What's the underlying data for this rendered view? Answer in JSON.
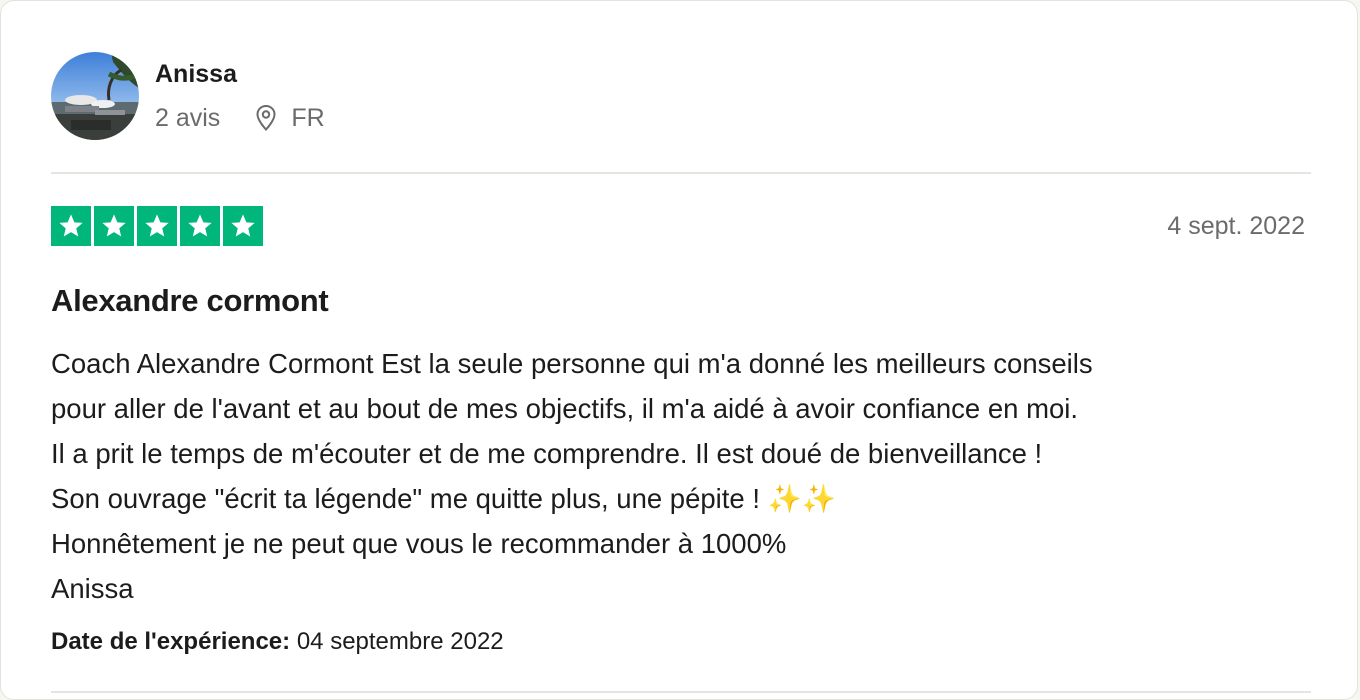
{
  "reviewer": {
    "name": "Anissa",
    "review_count": "2 avis",
    "country": "FR"
  },
  "review": {
    "rating": 5,
    "rating_color": "#00b67a",
    "date": "4 sept. 2022",
    "title": "Alexandre cormont",
    "lines": [
      "Coach Alexandre Cormont Est la seule personne qui m'a donné les meilleurs conseils",
      "pour aller de l'avant et au bout de mes objectifs, il m'a aidé à avoir confiance en moi.",
      "Il a prit le temps de m'écouter et de me comprendre. Il est doué de bienveillance !",
      "Son ouvrage \"écrit ta légende\" me quitte plus, une pépite ! ",
      "Honnêtement je ne peut que vous le recommander à 1000%",
      "Anissa"
    ],
    "sparkles": "✨✨",
    "experience_label": "Date de l'expérience:",
    "experience_date": "04 septembre 2022"
  },
  "icons": {
    "avatar": "profile-photo",
    "location": "location-pin-icon",
    "star": "star-icon"
  }
}
